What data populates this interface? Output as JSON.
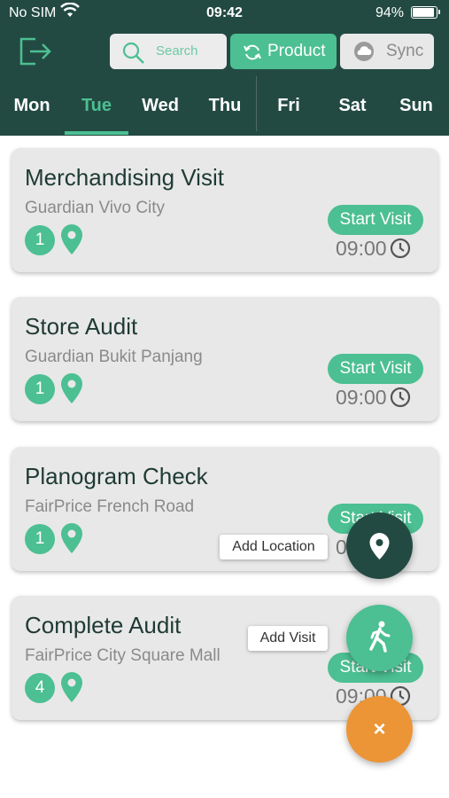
{
  "status_bar": {
    "carrier": "No SIM",
    "time": "09:42",
    "battery": "94%",
    "battery_level": 0.94
  },
  "toolbar": {
    "search_placeholder": "Search",
    "product_label": "Product",
    "sync_label": "Sync",
    "accent_color": "#4cbf93",
    "header_color": "#234a42"
  },
  "days": [
    {
      "label": "Mon",
      "active": false
    },
    {
      "label": "Tue",
      "active": true
    },
    {
      "label": "Wed",
      "active": false
    },
    {
      "label": "Thu",
      "active": false
    },
    {
      "label": "Fri",
      "active": false
    },
    {
      "label": "Sat",
      "active": false
    },
    {
      "label": "Sun",
      "active": false
    }
  ],
  "visits": [
    {
      "title": "Merchandising Visit",
      "location": "Guardian Vivo City",
      "count": "1",
      "action": "Start Visit",
      "time": "09:00"
    },
    {
      "title": "Store Audit",
      "location": "Guardian Bukit Panjang",
      "count": "1",
      "action": "Start Visit",
      "time": "09:00"
    },
    {
      "title": "Planogram Check",
      "location": "FairPrice French Road",
      "count": "1",
      "action": "Start Visit",
      "time": "09:00"
    },
    {
      "title": "Complete Audit",
      "location": "FairPrice City Square Mall",
      "count": "4",
      "action": "Start Visit",
      "time": "09:00"
    }
  ],
  "fab_menu": {
    "add_location_label": "Add Location",
    "add_visit_label": "Add Visit",
    "close_symbol": "×",
    "close_color": "#ec9536"
  }
}
